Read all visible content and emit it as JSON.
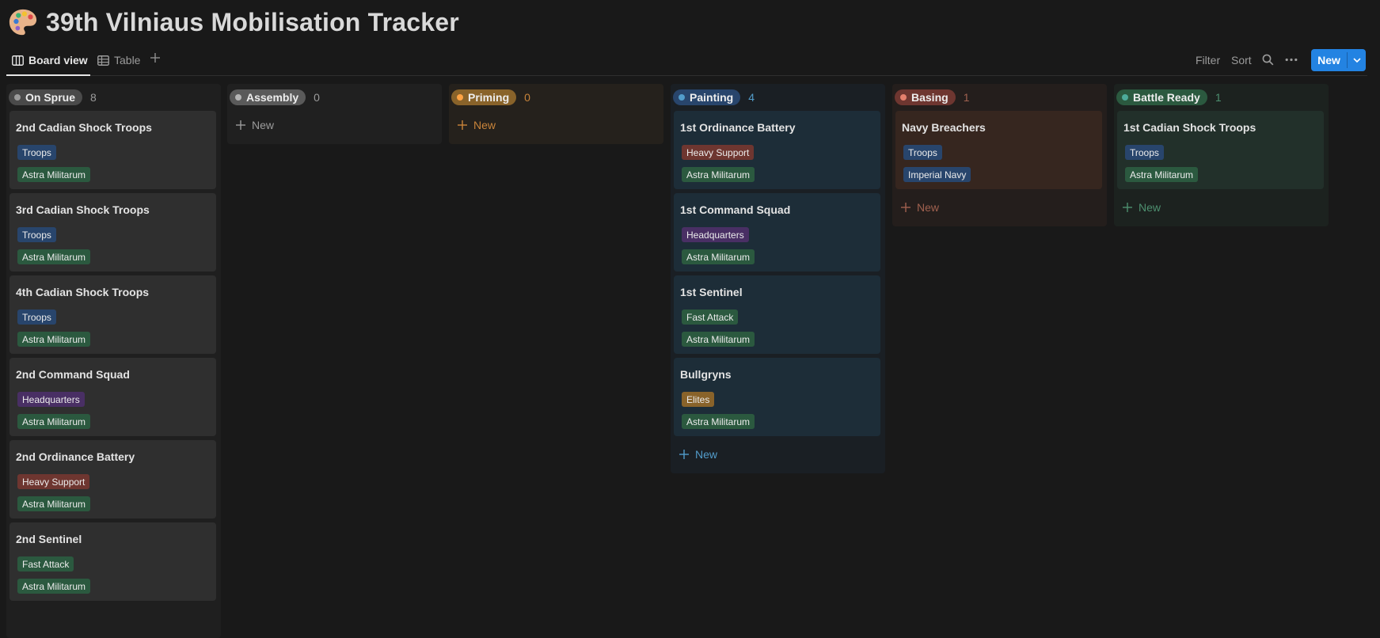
{
  "page": {
    "title": "39th Vilniaus Mobilisation Tracker",
    "icon": "palette-icon"
  },
  "views": {
    "tabs": [
      {
        "label": "Board view",
        "icon": "board-icon",
        "active": true
      },
      {
        "label": "Table",
        "icon": "table-icon",
        "active": false
      }
    ],
    "add_view_icon": "plus-icon"
  },
  "toolbar": {
    "filter_label": "Filter",
    "sort_label": "Sort",
    "search_icon": "search-icon",
    "more_icon": "more-icon",
    "new_label": "New",
    "new_dropdown_icon": "chevron-down-icon",
    "accent_color": "#2383e2"
  },
  "board": {
    "new_label": "New",
    "columns": [
      {
        "status": "On Sprue",
        "count": "8",
        "colors": {
          "bg": "#1f1f1f",
          "card": "#2f2f2f",
          "pill": "#4a4a4a",
          "dot": "#9b9b9b",
          "text": "#9b9b9b"
        },
        "cards": [
          {
            "title": "2nd Cadian Shock Troops",
            "tags": [
              {
                "label": "Troops",
                "color": "#28456c"
              },
              {
                "label": "Astra Militarum",
                "color": "#2b593f"
              }
            ]
          },
          {
            "title": "3rd Cadian Shock Troops",
            "tags": [
              {
                "label": "Troops",
                "color": "#28456c"
              },
              {
                "label": "Astra Militarum",
                "color": "#2b593f"
              }
            ]
          },
          {
            "title": "4th Cadian Shock Troops",
            "tags": [
              {
                "label": "Troops",
                "color": "#28456c"
              },
              {
                "label": "Astra Militarum",
                "color": "#2b593f"
              }
            ]
          },
          {
            "title": "2nd Command Squad",
            "tags": [
              {
                "label": "Headquarters",
                "color": "#492f64"
              },
              {
                "label": "Astra Militarum",
                "color": "#2b593f"
              }
            ]
          },
          {
            "title": "2nd Ordinance Battery",
            "tags": [
              {
                "label": "Heavy Support",
                "color": "#6e3630"
              },
              {
                "label": "Astra Militarum",
                "color": "#2b593f"
              }
            ]
          },
          {
            "title": "2nd Sentinel",
            "tags": [
              {
                "label": "Fast Attack",
                "color": "#2b593f"
              },
              {
                "label": "Astra Militarum",
                "color": "#2b593f"
              }
            ]
          }
        ],
        "show_new": false
      },
      {
        "status": "Assembly",
        "count": "0",
        "colors": {
          "bg": "#202020",
          "card": "#2f2f2f",
          "pill": "#5a5a5a",
          "dot": "#b5b5b5",
          "text": "#9b9b9b"
        },
        "cards": [],
        "show_new": true
      },
      {
        "status": "Priming",
        "count": "0",
        "colors": {
          "bg": "#25211c",
          "card": "#3a2f24",
          "pill": "#89632a",
          "dot": "#ffa344",
          "text": "#c9843a"
        },
        "cards": [],
        "show_new": true
      },
      {
        "status": "Painting",
        "count": "4",
        "colors": {
          "bg": "#1a1f24",
          "card": "#1d2d38",
          "pill": "#28456c",
          "dot": "#529cca",
          "text": "#529cca"
        },
        "cards": [
          {
            "title": "1st Ordinance Battery",
            "tags": [
              {
                "label": "Heavy Support",
                "color": "#6e3630"
              },
              {
                "label": "Astra Militarum",
                "color": "#2b593f"
              }
            ]
          },
          {
            "title": "1st Command Squad",
            "tags": [
              {
                "label": "Headquarters",
                "color": "#492f64"
              },
              {
                "label": "Astra Militarum",
                "color": "#2b593f"
              }
            ]
          },
          {
            "title": "1st Sentinel",
            "tags": [
              {
                "label": "Fast Attack",
                "color": "#2b593f"
              },
              {
                "label": "Astra Militarum",
                "color": "#2b593f"
              }
            ]
          },
          {
            "title": "Bullgryns",
            "tags": [
              {
                "label": "Elites",
                "color": "#89632a"
              },
              {
                "label": "Astra Militarum",
                "color": "#2b593f"
              }
            ]
          }
        ],
        "show_new": true
      },
      {
        "status": "Basing",
        "count": "1",
        "colors": {
          "bg": "#241e1c",
          "card": "#36261f",
          "pill": "#6e3630",
          "dot": "#e5806d",
          "text": "#a0614f"
        },
        "cards": [
          {
            "title": "Navy Breachers",
            "tags": [
              {
                "label": "Troops",
                "color": "#28456c"
              },
              {
                "label": "Imperial Navy",
                "color": "#28456c"
              }
            ]
          }
        ],
        "show_new": true
      },
      {
        "status": "Battle Ready",
        "count": "1",
        "colors": {
          "bg": "#1c221f",
          "card": "#22302a",
          "pill": "#2b593f",
          "dot": "#4dab9a",
          "text": "#4d8f6f"
        },
        "cards": [
          {
            "title": "1st Cadian Shock Troops",
            "tags": [
              {
                "label": "Troops",
                "color": "#28456c"
              },
              {
                "label": "Astra Militarum",
                "color": "#2b593f"
              }
            ]
          }
        ],
        "show_new": true
      }
    ]
  }
}
